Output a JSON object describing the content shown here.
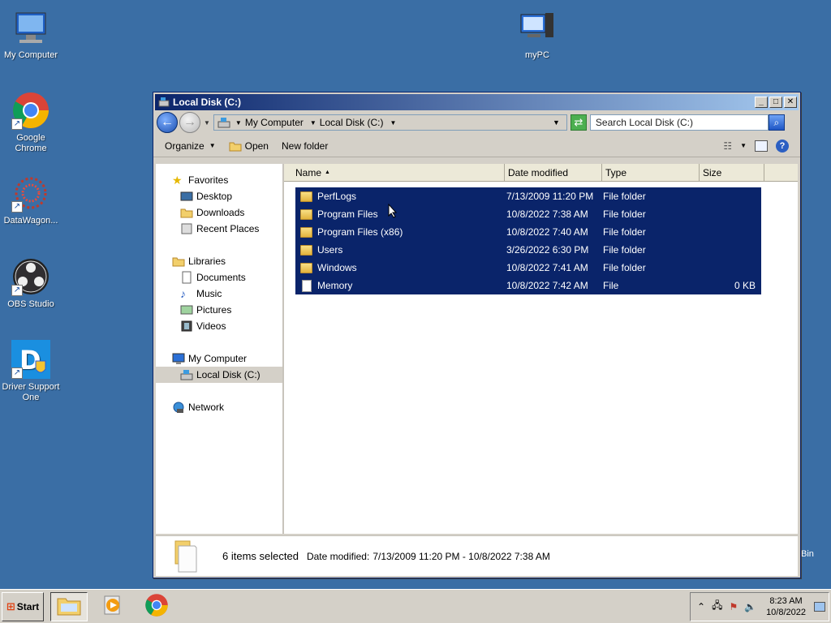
{
  "desktop": {
    "icons": [
      {
        "label": "My Computer"
      },
      {
        "label": "Google Chrome"
      },
      {
        "label": "DataWagon..."
      },
      {
        "label": "OBS Studio"
      },
      {
        "label": "Driver Support One"
      },
      {
        "label": "myPC"
      }
    ],
    "recycle_bin_partial": "Bin"
  },
  "window": {
    "title": "Local Disk (C:)",
    "buttons": {
      "minimize": "_",
      "maximize": "□",
      "close": "✕"
    },
    "address": {
      "crumbs": [
        "My Computer",
        "Local Disk (C:)"
      ]
    },
    "search": {
      "placeholder": "Search Local Disk (C:)"
    },
    "toolbar": {
      "organize": "Organize",
      "open": "Open",
      "new_folder": "New folder"
    },
    "nav": {
      "favorites": "Favorites",
      "desktop": "Desktop",
      "downloads": "Downloads",
      "recent_places": "Recent Places",
      "libraries": "Libraries",
      "documents": "Documents",
      "music": "Music",
      "pictures": "Pictures",
      "videos": "Videos",
      "my_computer": "My Computer",
      "local_disk": "Local Disk (C:)",
      "network": "Network"
    },
    "columns": {
      "name": "Name",
      "date_modified": "Date modified",
      "type": "Type",
      "size": "Size"
    },
    "files": [
      {
        "name": "PerfLogs",
        "date": "7/13/2009 11:20 PM",
        "type": "File folder",
        "size": ""
      },
      {
        "name": "Program Files",
        "date": "10/8/2022 7:38 AM",
        "type": "File folder",
        "size": ""
      },
      {
        "name": "Program Files (x86)",
        "date": "10/8/2022 7:40 AM",
        "type": "File folder",
        "size": ""
      },
      {
        "name": "Users",
        "date": "3/26/2022 6:30 PM",
        "type": "File folder",
        "size": ""
      },
      {
        "name": "Windows",
        "date": "10/8/2022 7:41 AM",
        "type": "File folder",
        "size": ""
      },
      {
        "name": "Memory",
        "date": "10/8/2022 7:42 AM",
        "type": "File",
        "size": "0 KB"
      }
    ],
    "status": {
      "count": "6 items selected",
      "date_label": "Date modified:",
      "date_range": "7/13/2009 11:20 PM - 10/8/2022 7:38 AM"
    }
  },
  "taskbar": {
    "start": "Start",
    "time": "8:23 AM",
    "date": "10/8/2022"
  },
  "colors": {
    "desktop_bg": "#3a6ea5",
    "selection": "#0a246a",
    "titlebar_start": "#0a246a",
    "titlebar_end": "#a6caf0"
  }
}
